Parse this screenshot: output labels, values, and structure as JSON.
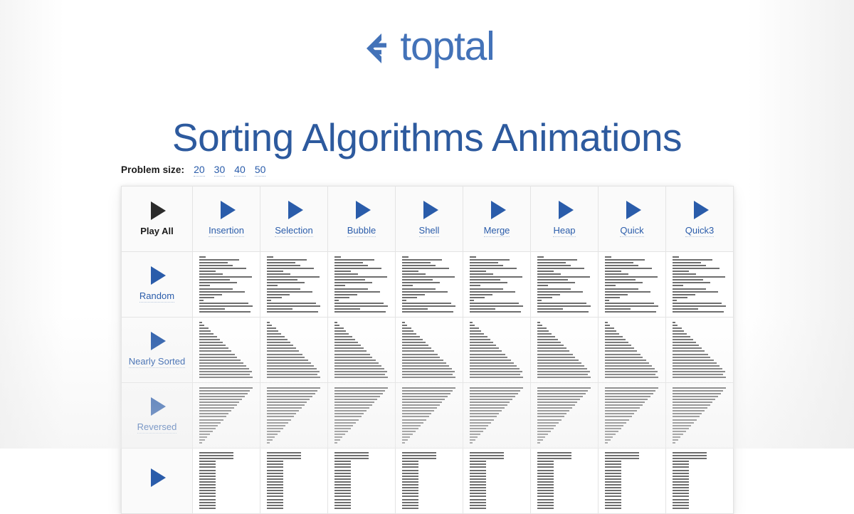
{
  "brand": {
    "word": "toptal",
    "mark_icon": "toptal-logo-mark",
    "color": "#4372b8"
  },
  "page_title": "Sorting Algorithms Animations",
  "controls": {
    "label": "Problem size:",
    "sizes": [
      "20",
      "30",
      "40",
      "50"
    ],
    "selected": "20"
  },
  "theme": {
    "link_blue": "#2a5caa",
    "title_blue": "#2d5a9e",
    "bar_gray": "#6e6e6e",
    "cell_bg": "#fafafa",
    "border": "#e4e4e4",
    "play_all_dark": "#2b2b2b"
  },
  "grid": {
    "columns": [
      {
        "label": "Play All",
        "icon": "play-triangle-icon",
        "style": "dark"
      },
      {
        "label": "Insertion",
        "icon": "play-triangle-icon",
        "style": "link"
      },
      {
        "label": "Selection",
        "icon": "play-triangle-icon",
        "style": "link"
      },
      {
        "label": "Bubble",
        "icon": "play-triangle-icon",
        "style": "link"
      },
      {
        "label": "Shell",
        "icon": "play-triangle-icon",
        "style": "link"
      },
      {
        "label": "Merge",
        "icon": "play-triangle-icon",
        "style": "link"
      },
      {
        "label": "Heap",
        "icon": "play-triangle-icon",
        "style": "link"
      },
      {
        "label": "Quick",
        "icon": "play-triangle-icon",
        "style": "link"
      },
      {
        "label": "Quick3",
        "icon": "play-triangle-icon",
        "style": "link"
      }
    ],
    "rows": [
      {
        "label": "Random",
        "icon": "play-triangle-icon",
        "clipped": false
      },
      {
        "label": "Nearly Sorted",
        "icon": "play-triangle-icon",
        "clipped": false
      },
      {
        "label": "Reversed",
        "icon": "play-triangle-icon",
        "clipped": false
      },
      {
        "label": "",
        "icon": "play-triangle-icon",
        "clipped": true
      }
    ]
  },
  "chart_data": {
    "type": "bar",
    "orientation": "horizontal",
    "title": "Sorting Algorithms Animations",
    "problem_size": 20,
    "bar_color": "#6e6e6e",
    "xlabel": "",
    "ylabel": "",
    "xlim": [
      0,
      100
    ],
    "grid": false,
    "legend": null,
    "note": "Each grid cell plots one array as horizontal bars; bar length = element value as percent of cell width. Row = initial array order, column = sorting algorithm.",
    "datasets": [
      {
        "name": "Random",
        "values": [
          12,
          74,
          53,
          63,
          88,
          30,
          44,
          99,
          57,
          70,
          20,
          62,
          85,
          43,
          28,
          8,
          92,
          100,
          48,
          96
        ]
      },
      {
        "name": "Nearly Sorted",
        "values": [
          5,
          9,
          17,
          21,
          27,
          33,
          38,
          44,
          49,
          55,
          60,
          66,
          71,
          77,
          82,
          88,
          93,
          99,
          95,
          100
        ]
      },
      {
        "name": "Reversed",
        "values": [
          100,
          95,
          90,
          85,
          80,
          75,
          70,
          65,
          60,
          55,
          50,
          45,
          40,
          35,
          30,
          25,
          20,
          15,
          10,
          5
        ]
      },
      {
        "name": "",
        "values": [
          64,
          64,
          64,
          30,
          30,
          30,
          30,
          30,
          30,
          30,
          30,
          30,
          30,
          30,
          30,
          30,
          30,
          30,
          30,
          30
        ]
      }
    ]
  }
}
